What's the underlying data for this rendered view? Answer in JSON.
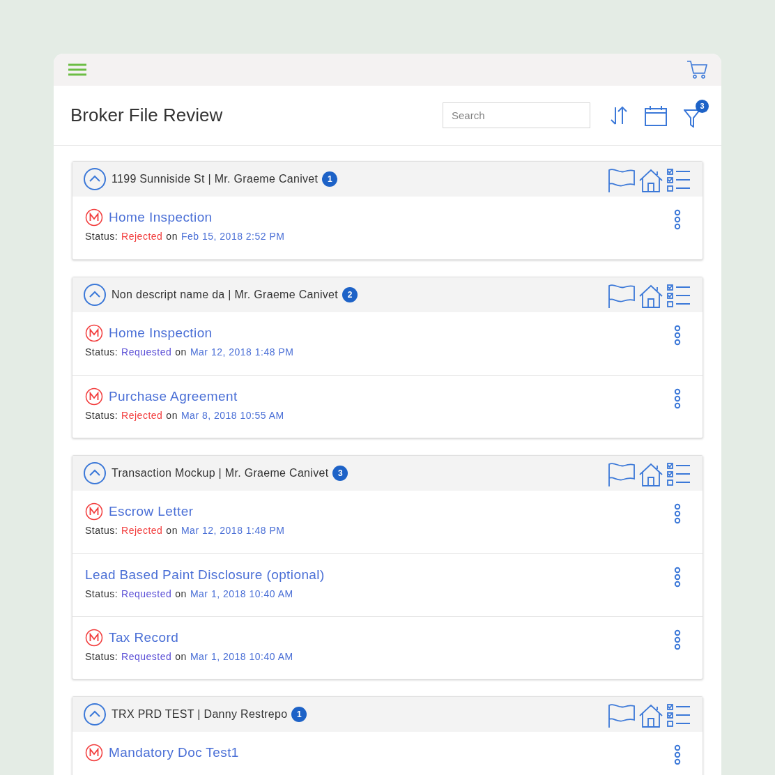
{
  "header": {
    "title": "Broker File Review",
    "search": {
      "placeholder": "Search"
    },
    "filter_count": "3"
  },
  "groups": [
    {
      "title": "1199 Sunniside St | Mr. Graeme Canivet",
      "count": "1",
      "expanded": true,
      "items": [
        {
          "name": "Home Inspection",
          "mandatory": true,
          "status_label": "Status:",
          "status": {
            "text": "Rejected",
            "color": "#f23b3b"
          },
          "on": "on",
          "date": "Feb 15, 2018 2:52 PM"
        }
      ]
    },
    {
      "title": "Non descript name da | Mr. Graeme Canivet",
      "count": "2",
      "expanded": true,
      "items": [
        {
          "name": "Home Inspection",
          "mandatory": true,
          "status_label": "Status:",
          "status": {
            "text": "Requested",
            "color": "#5b4fd6"
          },
          "on": "on",
          "date": "Mar 12, 2018 1:48 PM"
        },
        {
          "name": "Purchase Agreement",
          "mandatory": true,
          "status_label": "Status:",
          "status": {
            "text": "Rejected",
            "color": "#f23b3b"
          },
          "on": "on",
          "date": "Mar 8, 2018 10:55 AM"
        }
      ]
    },
    {
      "title": "Transaction Mockup | Mr. Graeme Canivet",
      "count": "3",
      "expanded": true,
      "items": [
        {
          "name": "Escrow Letter",
          "mandatory": true,
          "status_label": "Status:",
          "status": {
            "text": "Rejected",
            "color": "#f23b3b"
          },
          "on": "on",
          "date": "Mar 12, 2018 1:48 PM"
        },
        {
          "name": "Lead Based Paint Disclosure (optional)",
          "mandatory": false,
          "status_label": "Status:",
          "status": {
            "text": "Requested",
            "color": "#5b4fd6"
          },
          "on": "on",
          "date": "Mar 1, 2018 10:40 AM"
        },
        {
          "name": "Tax Record",
          "mandatory": true,
          "status_label": "Status:",
          "status": {
            "text": "Requested",
            "color": "#5b4fd6"
          },
          "on": "on",
          "date": "Mar 1, 2018 10:40 AM"
        }
      ]
    },
    {
      "title": "TRX PRD TEST | Danny Restrepo",
      "count": "1",
      "expanded": true,
      "items": [
        {
          "name": "Mandatory Doc Test1",
          "mandatory": true
        }
      ]
    }
  ]
}
